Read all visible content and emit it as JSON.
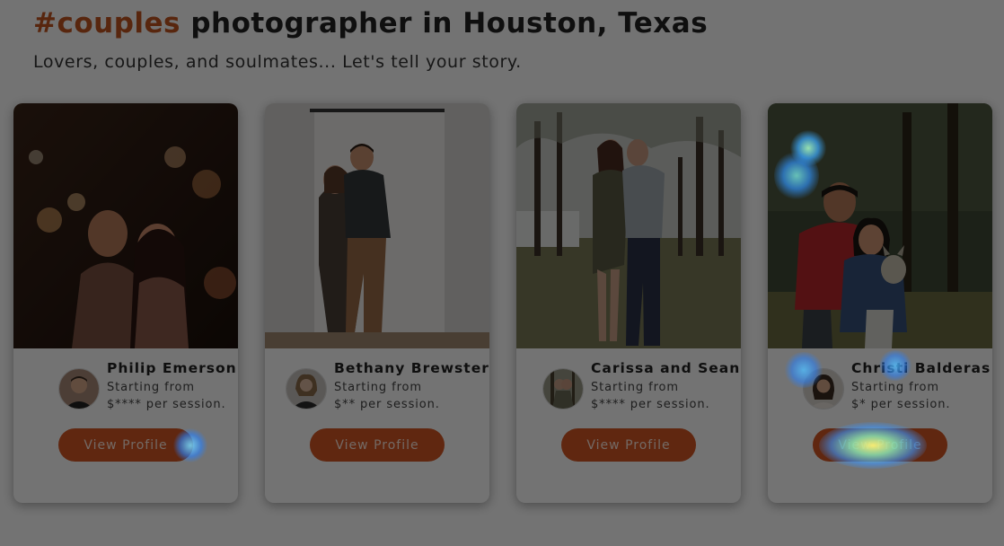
{
  "header": {
    "hashtag": "#couples",
    "title_rest": "photographer in Houston, Texas",
    "tagline": "Lovers, couples, and soulmates... Let's tell your story."
  },
  "photographers": [
    {
      "name": "Philip Emerson",
      "starting": "Starting from",
      "price": "$**** per session.",
      "button": "View Profile"
    },
    {
      "name": "Bethany Brewster",
      "starting": "Starting from",
      "price": "$** per session.",
      "button": "View Profile"
    },
    {
      "name": "Carissa and Sean",
      "starting": "Starting from",
      "price": "$**** per session.",
      "button": "View Profile"
    },
    {
      "name": "Christi Balderas",
      "starting": "Starting from",
      "price": "$* per session.",
      "button": "View Profile"
    }
  ],
  "colors": {
    "accent": "#c4561f",
    "button": "#d65724",
    "overlay": "rgba(0,0,0,0.55)"
  }
}
